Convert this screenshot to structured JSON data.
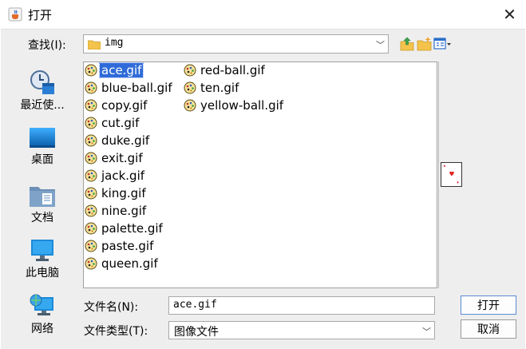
{
  "window": {
    "title": "打开"
  },
  "lookin": {
    "label": "查找(I):",
    "value": "img"
  },
  "places": [
    {
      "label": "最近使..."
    },
    {
      "label": "桌面"
    },
    {
      "label": "文档"
    },
    {
      "label": "此电脑"
    },
    {
      "label": "网络"
    }
  ],
  "files": [
    {
      "name": "ace.gif",
      "selected": true
    },
    {
      "name": "blue-ball.gif"
    },
    {
      "name": "copy.gif"
    },
    {
      "name": "cut.gif"
    },
    {
      "name": "duke.gif"
    },
    {
      "name": "exit.gif"
    },
    {
      "name": "jack.gif"
    },
    {
      "name": "king.gif"
    },
    {
      "name": "nine.gif"
    },
    {
      "name": "palette.gif"
    },
    {
      "name": "paste.gif"
    },
    {
      "name": "queen.gif"
    },
    {
      "name": "red-ball.gif"
    },
    {
      "name": "ten.gif"
    },
    {
      "name": "yellow-ball.gif"
    }
  ],
  "filename": {
    "label": "文件名(N):",
    "value": "ace.gif"
  },
  "filetype": {
    "label": "文件类型(T):",
    "value": "图像文件"
  },
  "buttons": {
    "open": "打开",
    "cancel": "取消"
  },
  "colors": {
    "selection": "#2f6bd8",
    "background": "#eeeeee"
  }
}
